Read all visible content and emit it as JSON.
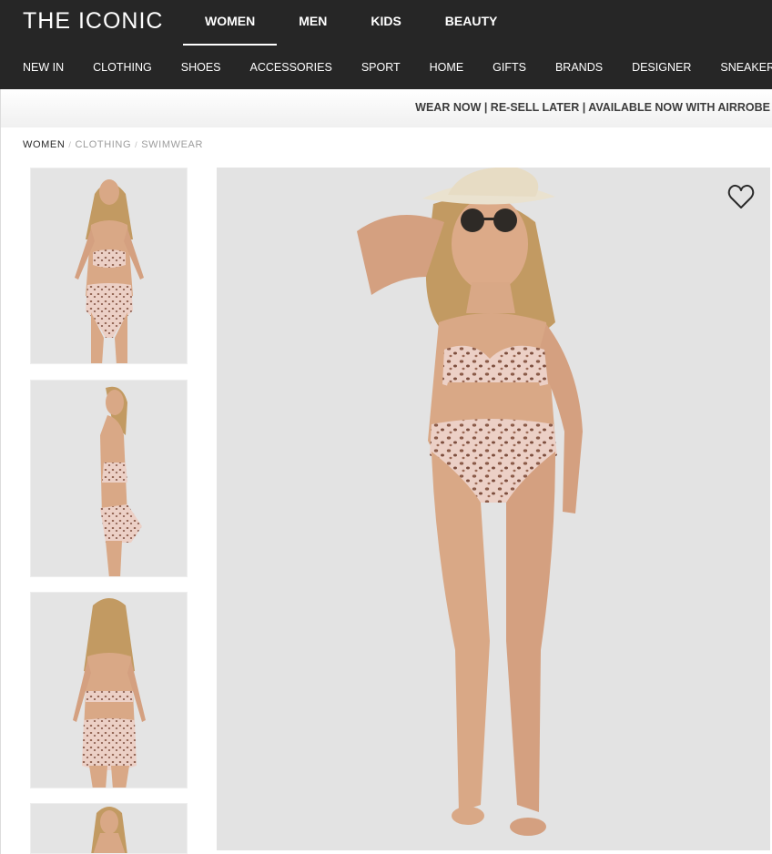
{
  "brand": {
    "logo_text": "THE ICONIC"
  },
  "gender_tabs": [
    {
      "label": "WOMEN",
      "active": true
    },
    {
      "label": "MEN",
      "active": false
    },
    {
      "label": "KIDS",
      "active": false
    },
    {
      "label": "BEAUTY",
      "active": false
    }
  ],
  "category_nav": [
    "NEW IN",
    "CLOTHING",
    "SHOES",
    "ACCESSORIES",
    "SPORT",
    "HOME",
    "GIFTS",
    "BRANDS",
    "DESIGNER",
    "SNEAKERHUB"
  ],
  "promo_banner": "WEAR NOW | RE-SELL LATER | AVAILABLE NOW WITH AIRROBE",
  "breadcrumb": {
    "current": "WOMEN",
    "links": [
      "CLOTHING",
      "SWIMWEAR"
    ],
    "separator": "/"
  },
  "product_gallery": {
    "thumbnails": [
      {
        "view": "front"
      },
      {
        "view": "side"
      },
      {
        "view": "back"
      },
      {
        "view": "front"
      }
    ],
    "main_image": {
      "view": "front",
      "accessories": [
        "hat",
        "sunglasses"
      ]
    },
    "wishlist_icon": "heart-icon"
  },
  "colors": {
    "header_bg": "#262626",
    "image_bg": "#e3e3e3",
    "swimsuit": "#e7c9c0",
    "leopard_spot": "#8a5a48",
    "skin": "#d9a886",
    "hair": "#c29a62"
  }
}
